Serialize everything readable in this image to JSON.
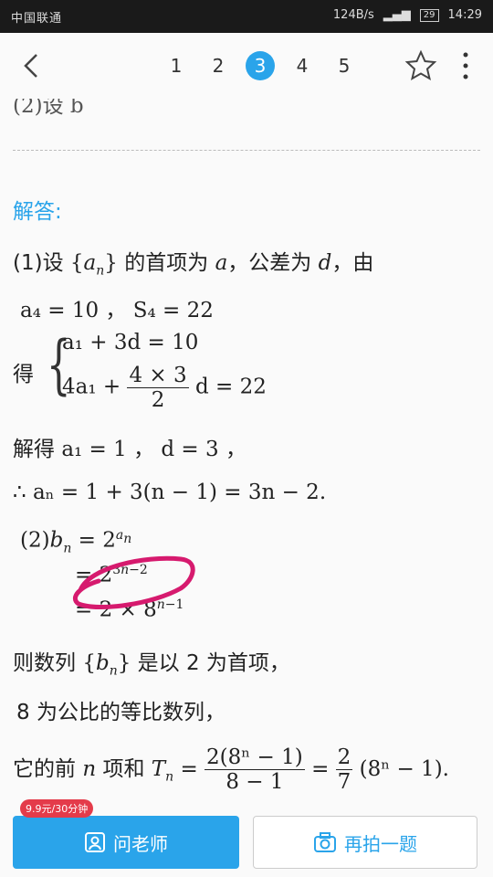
{
  "status": {
    "carrier": "中国联通",
    "speed": "124B/s",
    "battery": "29",
    "time": "14:29",
    "signal": "4G"
  },
  "nav": {
    "pages": [
      "1",
      "2",
      "3",
      "4",
      "5"
    ],
    "active_index": 2
  },
  "content": {
    "cut_line": "(2)设 b",
    "answer_label": "解答:",
    "p1_a": "(1)设",
    "p1_b": "的首项为",
    "p1_c": "，公差为",
    "p1_d": "，由",
    "eq1": "a₄ = 10 ，  S₄ = 22",
    "de": "得",
    "sys1": "a₁ + 3d = 10",
    "sys2_a": "4a₁ +",
    "sys2_num": "4 × 3",
    "sys2_den": "2",
    "sys2_b": "d = 22",
    "solve_a": "解得",
    "solve_b": "a₁ = 1 ，  d = 3 ，",
    "therefore": "∴ aₙ = 1 + 3(n − 1) = 3n − 2.",
    "p2_1": "(2)",
    "p2_2": "= 2",
    "p2_3": "= 2 × 8",
    "seq_a": "则数列",
    "seq_b": "是以 2 为首项，",
    "ratio": "8 为公比的等比数列，",
    "sum_a": "它的前",
    "sum_b": "项和",
    "sum_num": "2(8ⁿ − 1)",
    "sum_den": "8 − 1",
    "sum_num2": "2",
    "sum_den2": "7",
    "sum_tail": "(8ⁿ − 1)."
  },
  "bottom": {
    "promo": "9.9元/30分钟",
    "ask_teacher": "问老师",
    "retake": "再拍一题"
  },
  "colors": {
    "accent": "#2aa4ea",
    "pink_mark": "#d61a6e"
  }
}
